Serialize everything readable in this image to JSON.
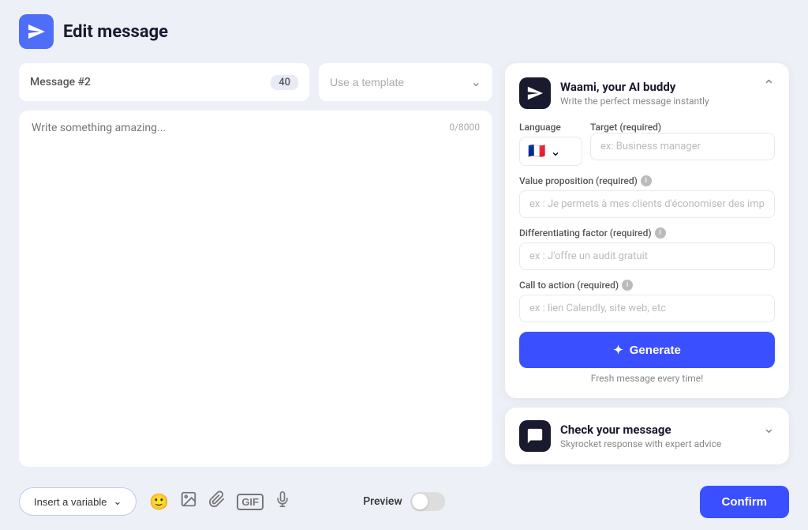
{
  "header": {
    "title": "Edit message",
    "icon_label": "paper-plane-icon"
  },
  "left_panel": {
    "message_label": "Message #2",
    "message_count": "40",
    "template_placeholder": "Use a template",
    "char_count": "0/8000",
    "textarea_placeholder": "Write something amazing..."
  },
  "right_panel": {
    "ai_buddy": {
      "title": "Waami, your AI buddy",
      "subtitle": "Write the perfect message instantly",
      "language_label": "Language",
      "flag": "🇫🇷",
      "target_label": "Target (required)",
      "target_placeholder": "ex: Business manager",
      "value_prop_label": "Value proposition (required)",
      "value_prop_placeholder": "ex : Je permets à mes clients d'économiser des impôts",
      "diff_factor_label": "Differentiating factor (required)",
      "diff_factor_placeholder": "ex : J'offre un audit gratuit",
      "cta_label": "Call to action (required)",
      "cta_placeholder": "ex : lien Calendly, site web, etc",
      "generate_label": "Generate",
      "generate_subtext": "Fresh message every time!",
      "collapse_icon": "chevron-up-icon"
    },
    "check_message": {
      "title": "Check your message",
      "subtitle": "Skyrocket response with expert advice",
      "expand_icon": "chevron-down-icon"
    }
  },
  "bottom_bar": {
    "insert_variable_label": "Insert a variable",
    "preview_label": "Preview",
    "confirm_label": "Confirm",
    "icons": [
      {
        "name": "emoji-icon",
        "symbol": "😊"
      },
      {
        "name": "image-icon",
        "symbol": "🖼"
      },
      {
        "name": "attachment-icon",
        "symbol": "📎"
      },
      {
        "name": "gif-icon",
        "symbol": "GIF"
      },
      {
        "name": "mic-icon",
        "symbol": "🎤"
      }
    ]
  }
}
